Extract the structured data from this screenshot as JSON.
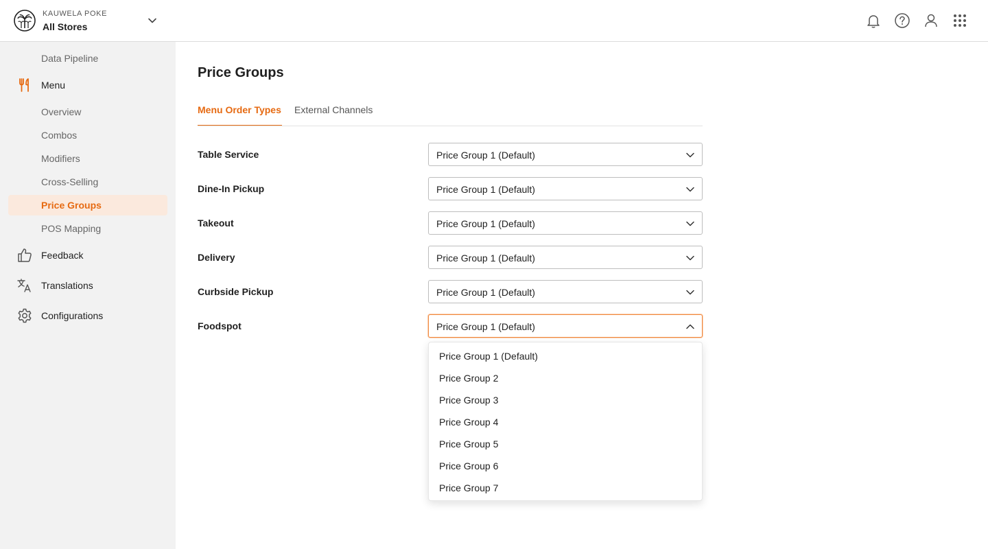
{
  "header": {
    "brand_sub": "KAUWELA POKE",
    "store_name": "All Stores",
    "icons": [
      "bell-icon",
      "help-icon",
      "user-icon",
      "apps-grid-icon"
    ]
  },
  "sidebar": {
    "items": [
      {
        "label": "Data Pipeline",
        "type": "sub"
      },
      {
        "label": "Menu",
        "type": "main",
        "icon": "fork-knife-icon",
        "color": "#e66a12"
      },
      {
        "label": "Overview",
        "type": "sub"
      },
      {
        "label": "Combos",
        "type": "sub"
      },
      {
        "label": "Modifiers",
        "type": "sub"
      },
      {
        "label": "Cross-Selling",
        "type": "sub"
      },
      {
        "label": "Price Groups",
        "type": "sub",
        "active": true
      },
      {
        "label": "POS Mapping",
        "type": "sub"
      },
      {
        "label": "Feedback",
        "type": "main",
        "icon": "thumbs-up-icon"
      },
      {
        "label": "Translations",
        "type": "main",
        "icon": "translate-icon"
      },
      {
        "label": "Configurations",
        "type": "main",
        "icon": "gear-icon"
      }
    ]
  },
  "main": {
    "title": "Price Groups",
    "tabs": [
      {
        "label": "Menu Order Types",
        "active": true
      },
      {
        "label": "External Channels",
        "active": false
      }
    ],
    "rows": [
      {
        "label": "Table Service",
        "value": "Price Group 1 (Default)"
      },
      {
        "label": "Dine-In Pickup",
        "value": "Price Group 1 (Default)"
      },
      {
        "label": "Takeout",
        "value": "Price Group 1 (Default)"
      },
      {
        "label": "Delivery",
        "value": "Price Group 1 (Default)"
      },
      {
        "label": "Curbside Pickup",
        "value": "Price Group 1 (Default)"
      },
      {
        "label": "Foodspot",
        "value": "Price Group 1 (Default)",
        "open": true
      }
    ],
    "dropdown_options": [
      "Price Group 1 (Default)",
      "Price Group 2",
      "Price Group 3",
      "Price Group 4",
      "Price Group 5",
      "Price Group 6",
      "Price Group 7"
    ]
  },
  "colors": {
    "accent": "#e66a12",
    "active_bg": "#fbe9dd",
    "sidebar_bg": "#f2f2f2"
  }
}
